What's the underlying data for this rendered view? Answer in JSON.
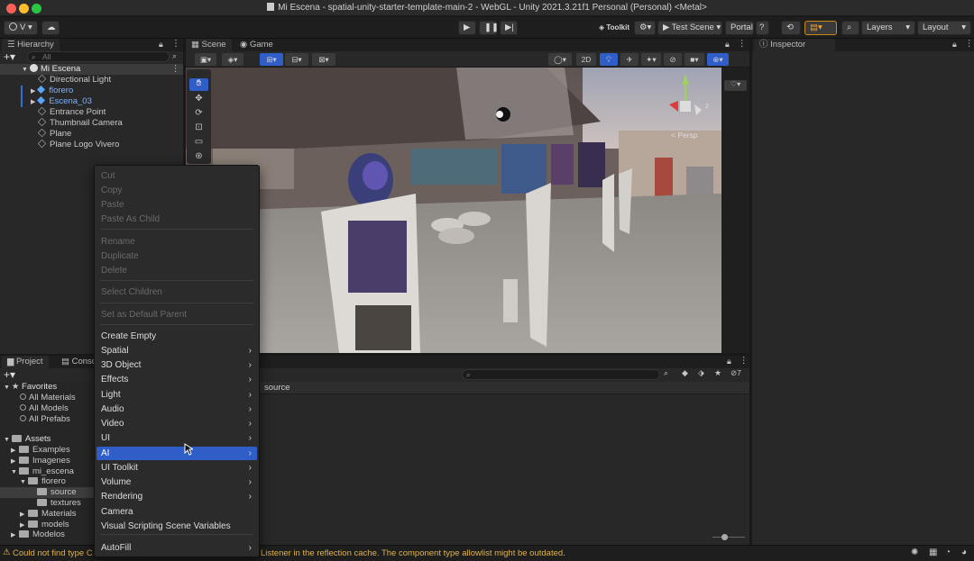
{
  "window": {
    "title": "Mi Escena - spatial-unity-starter-template-main-2 - WebGL - Unity 2021.3.21f1 Personal (Personal) <Metal>"
  },
  "toolbar": {
    "account_label": "V",
    "toolkit_label": "Toolkit",
    "test_scene_label": "Test Scene",
    "portal_label": "Portal",
    "help_label": "?",
    "layers_label": "Layers",
    "layout_label": "Layout"
  },
  "hierarchy": {
    "tab_label": "Hierarchy",
    "search_placeholder": "All",
    "scene_name": "Mi Escena",
    "items": [
      {
        "label": "Directional Light",
        "prefab": false
      },
      {
        "label": "florero",
        "prefab": true
      },
      {
        "label": "Escena_03",
        "prefab": true
      },
      {
        "label": "Entrance Point",
        "prefab": false
      },
      {
        "label": "Thumbnail Camera",
        "prefab": false
      },
      {
        "label": "Plane",
        "prefab": false
      },
      {
        "label": "Plane Logo Vivero",
        "prefab": false
      }
    ]
  },
  "scene_view": {
    "tab_scene": "Scene",
    "tab_game": "Game",
    "btn_2d": "2D",
    "persp_label": "< Persp"
  },
  "inspector": {
    "tab_label": "Inspector"
  },
  "project": {
    "tab_project": "Project",
    "tab_console": "Conso",
    "favorites_label": "Favorites",
    "favorites": [
      "All Materials",
      "All Models",
      "All Prefabs"
    ],
    "assets_label": "Assets",
    "folders": [
      {
        "label": "Examples",
        "depth": 1
      },
      {
        "label": "Imagenes",
        "depth": 1
      },
      {
        "label": "mi_escena",
        "depth": 1
      },
      {
        "label": "florero",
        "depth": 2
      },
      {
        "label": "source",
        "depth": 3
      },
      {
        "label": "textures",
        "depth": 3
      },
      {
        "label": "Materials",
        "depth": 2
      },
      {
        "label": "models",
        "depth": 2
      },
      {
        "label": "Modelos",
        "depth": 1
      }
    ],
    "content_header": "source",
    "hidden_count": "7"
  },
  "context_menu": {
    "items": [
      {
        "label": "Cut",
        "disabled": true
      },
      {
        "label": "Copy",
        "disabled": true
      },
      {
        "label": "Paste",
        "disabled": true
      },
      {
        "label": "Paste As Child",
        "disabled": true
      },
      {
        "label": "Rename",
        "disabled": true
      },
      {
        "label": "Duplicate",
        "disabled": true
      },
      {
        "label": "Delete",
        "disabled": true
      },
      {
        "label": "Select Children",
        "disabled": true
      },
      {
        "label": "Set as Default Parent",
        "disabled": true
      },
      {
        "label": "Create Empty",
        "disabled": false
      },
      {
        "label": "Spatial",
        "disabled": false,
        "submenu": true
      },
      {
        "label": "3D Object",
        "disabled": false,
        "submenu": true
      },
      {
        "label": "Effects",
        "disabled": false,
        "submenu": true
      },
      {
        "label": "Light",
        "disabled": false,
        "submenu": true
      },
      {
        "label": "Audio",
        "disabled": false,
        "submenu": true
      },
      {
        "label": "Video",
        "disabled": false,
        "submenu": true
      },
      {
        "label": "UI",
        "disabled": false,
        "submenu": true
      },
      {
        "label": "AI",
        "disabled": false,
        "submenu": true,
        "highlighted": true
      },
      {
        "label": "UI Toolkit",
        "disabled": false,
        "submenu": true
      },
      {
        "label": "Volume",
        "disabled": false,
        "submenu": true
      },
      {
        "label": "Rendering",
        "disabled": false,
        "submenu": true
      },
      {
        "label": "Camera",
        "disabled": false
      },
      {
        "label": "Visual Scripting Scene Variables",
        "disabled": false
      },
      {
        "label": "AutoFill",
        "disabled": false,
        "submenu": true
      }
    ]
  },
  "status": {
    "message_left": "Could not find type C",
    "message_right": "Listener in the reflection cache. The component type allowlist might be outdated."
  }
}
